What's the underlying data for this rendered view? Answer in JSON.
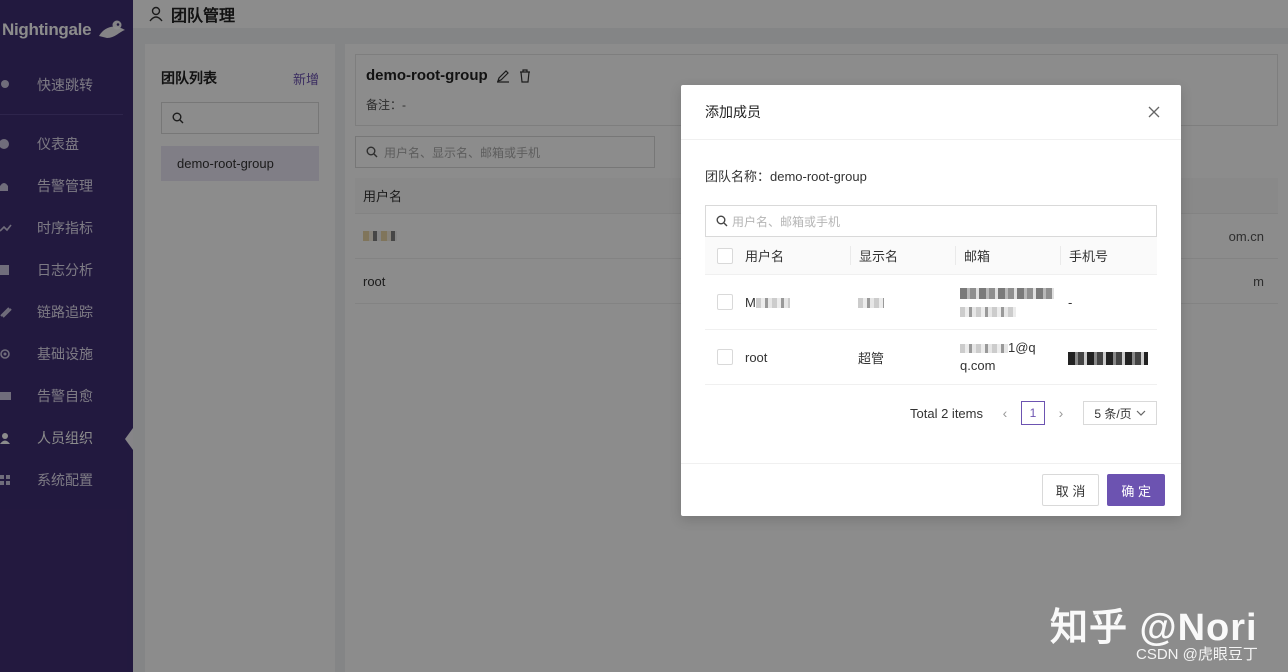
{
  "sidebar": {
    "logo": "Nightingale",
    "items": [
      {
        "label": "快速跳转",
        "icon": "search-icon"
      },
      {
        "label": "仪表盘",
        "icon": "dashboard-icon"
      },
      {
        "label": "告警管理",
        "icon": "alarm-icon"
      },
      {
        "label": "时序指标",
        "icon": "chart-line-icon"
      },
      {
        "label": "日志分析",
        "icon": "log-icon"
      },
      {
        "label": "链路追踪",
        "icon": "trace-icon"
      },
      {
        "label": "基础设施",
        "icon": "infrastructure-icon"
      },
      {
        "label": "告警自愈",
        "icon": "terminal-icon"
      },
      {
        "label": "人员组织",
        "icon": "user-icon"
      },
      {
        "label": "系统配置",
        "icon": "settings-icon"
      }
    ]
  },
  "header": {
    "title": "团队管理"
  },
  "team_panel": {
    "title": "团队列表",
    "new_label": "新增",
    "teams": [
      "demo-root-group"
    ]
  },
  "main": {
    "group_name": "demo-root-group",
    "note": "备注：-",
    "search_placeholder": "用户名、显示名、邮箱或手机",
    "column_username": "用户名",
    "rows": [
      {
        "username": "",
        "right": "om.cn"
      },
      {
        "username": "root",
        "right": "m"
      }
    ]
  },
  "modal": {
    "title": "添加成员",
    "team_label": "团队名称：demo-root-group",
    "search_placeholder": "用户名、邮箱或手机",
    "columns": [
      "用户名",
      "显示名",
      "邮箱",
      "手机号"
    ],
    "rows": [
      {
        "username": "M",
        "display": "",
        "email": "",
        "phone": "-"
      },
      {
        "username": "root",
        "display": "超管",
        "email_tail": "1@q",
        "email_line2": "q.com",
        "phone": ""
      }
    ],
    "pagination": {
      "total": "Total 2 items",
      "current_page": "1",
      "page_size": "5 条/页"
    },
    "cancel_label": "取 消",
    "ok_label": "确 定"
  },
  "watermark": {
    "main": "知乎 @Nori",
    "sub": "CSDN @虎眼豆丁"
  },
  "colors": {
    "sidebar_bg": "#3f2e73",
    "accent": "#6c53b1"
  }
}
